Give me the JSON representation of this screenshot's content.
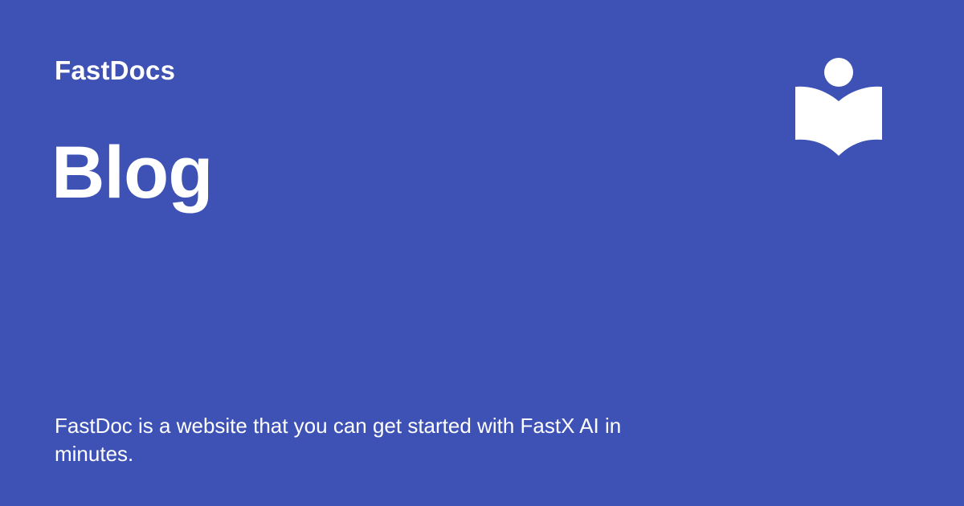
{
  "header": {
    "site_name": "FastDocs",
    "logo_icon": "open-book-reader-icon"
  },
  "main": {
    "title": "Blog",
    "description": "FastDoc is a website that you can get started with FastX AI in minutes."
  },
  "colors": {
    "background": "#3e51b5",
    "foreground": "#ffffff"
  }
}
